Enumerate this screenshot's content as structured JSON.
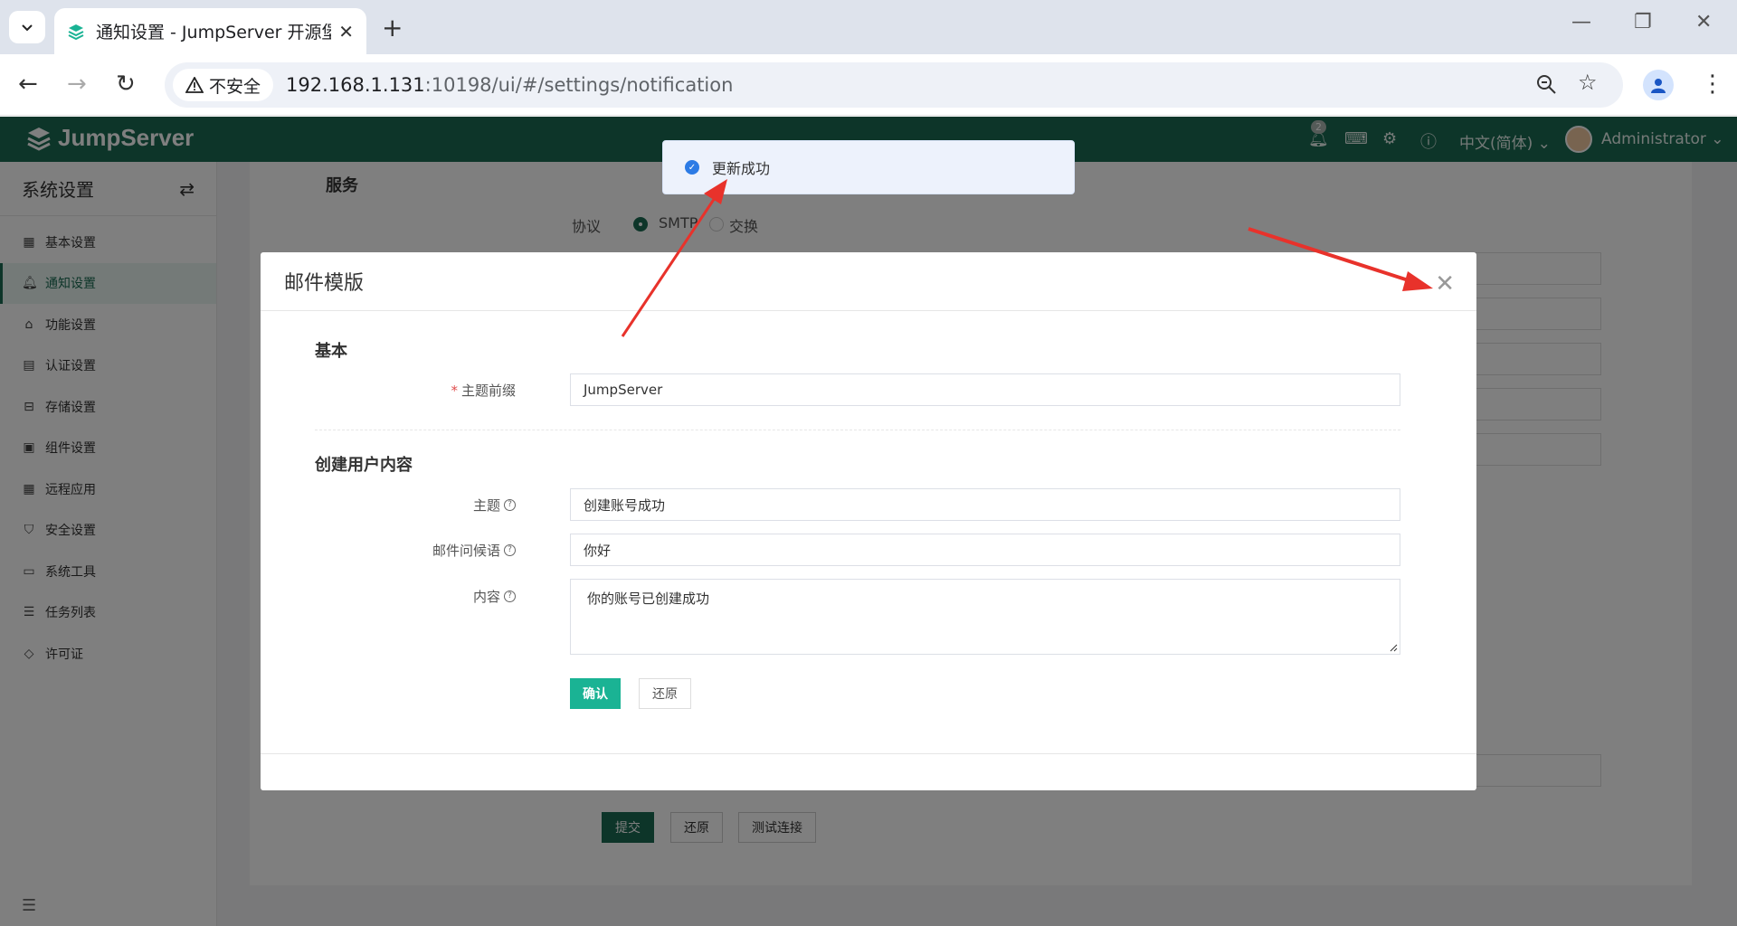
{
  "browser": {
    "tab_title": "通知设置 - JumpServer 开源堡",
    "security_label": "不安全",
    "url_host": "192.168.1.131",
    "url_rest": ":10198/ui/#/settings/notification"
  },
  "app": {
    "logo_text": "JumpServer",
    "notif_count": "2",
    "language": "中文(简体)",
    "user_name": "Administrator"
  },
  "sidebar": {
    "title": "系统设置",
    "items": [
      {
        "label": "基本设置",
        "icon": "grid-icon"
      },
      {
        "label": "通知设置",
        "icon": "bell-icon"
      },
      {
        "label": "功能设置",
        "icon": "basket-icon"
      },
      {
        "label": "认证设置",
        "icon": "id-card-icon"
      },
      {
        "label": "存储设置",
        "icon": "inbox-icon"
      },
      {
        "label": "组件设置",
        "icon": "terminal-icon"
      },
      {
        "label": "远程应用",
        "icon": "apps-icon"
      },
      {
        "label": "安全设置",
        "icon": "shield-icon"
      },
      {
        "label": "系统工具",
        "icon": "toolbox-icon"
      },
      {
        "label": "任务列表",
        "icon": "list-icon"
      },
      {
        "label": "许可证",
        "icon": "diamond-icon"
      }
    ]
  },
  "background": {
    "section_title": "服务",
    "protocol_label": "协议",
    "protocol_options": [
      "SMTP",
      "交换"
    ],
    "buttons": {
      "submit": "提交",
      "reset": "还原",
      "test": "测试连接"
    }
  },
  "toast": {
    "text": "更新成功"
  },
  "modal": {
    "title": "邮件模版",
    "section_basic": "基本",
    "subject_prefix_label": "主题前缀",
    "subject_prefix_value": "JumpServer",
    "section_create_user": "创建用户内容",
    "subject_label": "主题",
    "subject_value": "创建账号成功",
    "greeting_label": "邮件问候语",
    "greeting_value": "你好",
    "content_label": "内容",
    "content_value": "你的账号已创建成功",
    "confirm_button": "确认",
    "reset_button": "还原"
  },
  "colors": {
    "brand": "#1b6b53",
    "primary_button": "#1ab394",
    "annotation_arrow": "#e8322b"
  }
}
